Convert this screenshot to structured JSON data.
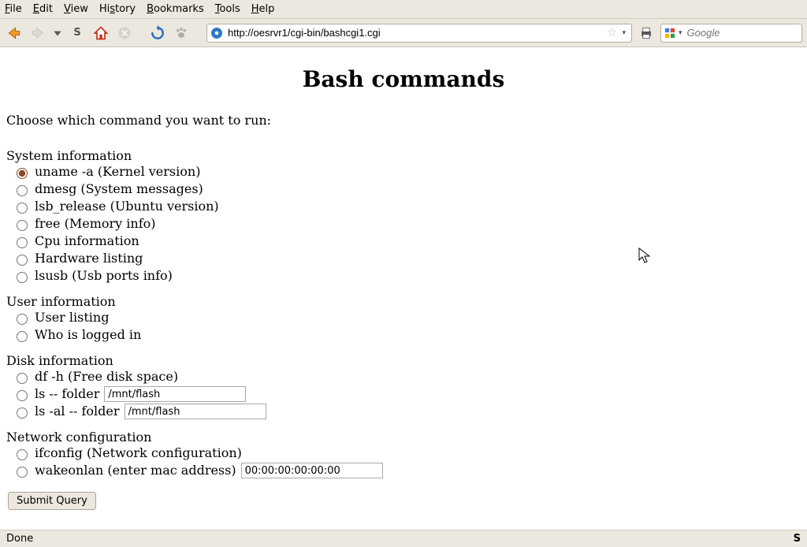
{
  "menu": {
    "file": "File",
    "edit": "Edit",
    "view": "View",
    "history": "History",
    "bookmarks": "Bookmarks",
    "tools": "Tools",
    "help": "Help"
  },
  "toolbar": {
    "url": "http://oesrvr1/cgi-bin/bashcgi1.cgi",
    "search_placeholder": "Google"
  },
  "page": {
    "title": "Bash commands",
    "prompt": "Choose which command you want to run:",
    "sections": {
      "systeminfo": {
        "label": "System information",
        "opt_uname": "uname -a (Kernel version)",
        "opt_dmesg": "dmesg (System messages)",
        "opt_lsb": "lsb_release (Ubuntu version)",
        "opt_free": "free (Memory info)",
        "opt_cpu": "Cpu information",
        "opt_hw": "Hardware listing",
        "opt_lsusb": "lsusb (Usb ports info)"
      },
      "userinfo": {
        "label": "User information",
        "opt_users": "User listing",
        "opt_who": "Who is logged in"
      },
      "diskinfo": {
        "label": "Disk information",
        "opt_df": "df -h (Free disk space)",
        "opt_ls": "ls -- folder",
        "opt_lsal": "ls -al -- folder",
        "ls_value": "/mnt/flash",
        "lsal_value": "/mnt/flash"
      },
      "netconf": {
        "label": "Network configuration",
        "opt_ifconfig": "ifconfig (Network configuration)",
        "opt_wol": "wakeonlan (enter mac address)",
        "wol_value": "00:00:00:00:00:00"
      }
    },
    "submit": "Submit Query"
  },
  "statusbar": {
    "left": "Done",
    "right": "S"
  }
}
